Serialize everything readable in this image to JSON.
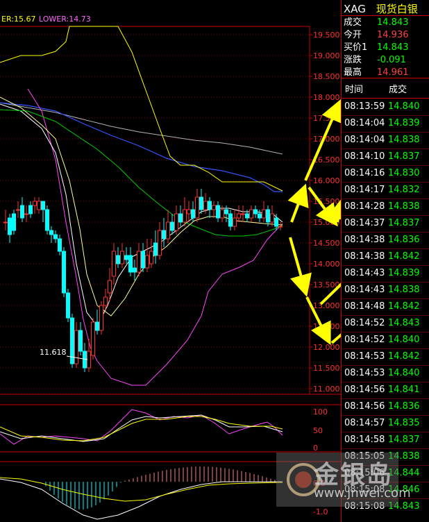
{
  "indicator": {
    "upper": "ER:15.67",
    "lower": "LOWER:14.73"
  },
  "y_axis": [
    "19.500",
    "19.000",
    "18.500",
    "18.000",
    "17.500",
    "17.000",
    "16.500",
    "16.000",
    "15.500",
    "15.000",
    "14.500",
    "14.000",
    "13.500",
    "13.000",
    "12.500",
    "12.000",
    "11.500",
    "11.000"
  ],
  "low_label": "11.618",
  "osc1_ticks": [
    "100",
    "50",
    "0"
  ],
  "osc2_ticks": [
    "0.0",
    "-1.0"
  ],
  "quote": {
    "symbol": "XAG",
    "name": "现货白银",
    "rows": [
      {
        "label": "成交",
        "value": "14.843",
        "color": "#00ff00"
      },
      {
        "label": "今开",
        "value": "14.936",
        "color": "#ff4040"
      },
      {
        "label": "买价1",
        "value": "14.843",
        "color": "#00ff00"
      },
      {
        "label": "涨跌",
        "value": "-0.091",
        "color": "#00ff00"
      },
      {
        "label": "最高",
        "value": "14.961",
        "color": "#ff4040"
      }
    ]
  },
  "ticks_header": {
    "time": "时间",
    "price": "成交"
  },
  "ticks": [
    {
      "time": "08:13:59",
      "price": "14.840"
    },
    {
      "time": "08:14:04",
      "price": "14.839"
    },
    {
      "time": "08:14:04",
      "price": "14.838"
    },
    {
      "time": "08:14:10",
      "price": "14.837"
    },
    {
      "time": "08:14:16",
      "price": "14.830"
    },
    {
      "time": "08:14:17",
      "price": "14.832"
    },
    {
      "time": "08:14:28",
      "price": "14.838"
    },
    {
      "time": "08:14:37",
      "price": "14.837"
    },
    {
      "time": "08:14:38",
      "price": "14.836"
    },
    {
      "time": "08:14:38",
      "price": "14.842"
    },
    {
      "time": "08:14:43",
      "price": "14.839"
    },
    {
      "time": "08:14:43",
      "price": "14.838"
    },
    {
      "time": "08:14:48",
      "price": "14.842"
    },
    {
      "time": "08:14:52",
      "price": "14.843"
    },
    {
      "time": "08:14:52",
      "price": "14.840"
    },
    {
      "time": "08:14:53",
      "price": "14.842"
    },
    {
      "time": "08:14:53",
      "price": "14.840"
    },
    {
      "time": "08:14:56",
      "price": "14.841"
    },
    {
      "time": "08:14:56",
      "price": "14.836"
    },
    {
      "time": "08:14:57",
      "price": "14.835"
    },
    {
      "time": "08:14:58",
      "price": "14.837"
    },
    {
      "time": "08:15:05",
      "price": "14.838"
    },
    {
      "time": "08:15:06",
      "price": "14.844"
    },
    {
      "time": "08:15:08",
      "price": "14.846"
    },
    {
      "time": "08:15:08",
      "price": "14.843"
    }
  ],
  "watermark": {
    "main": "金银岛",
    "url": "www.jnwei.com"
  },
  "colors": {
    "up": "#ff3030",
    "down": "#00ffff",
    "grid": "#8b0000",
    "arrow": "#ffff00"
  }
}
